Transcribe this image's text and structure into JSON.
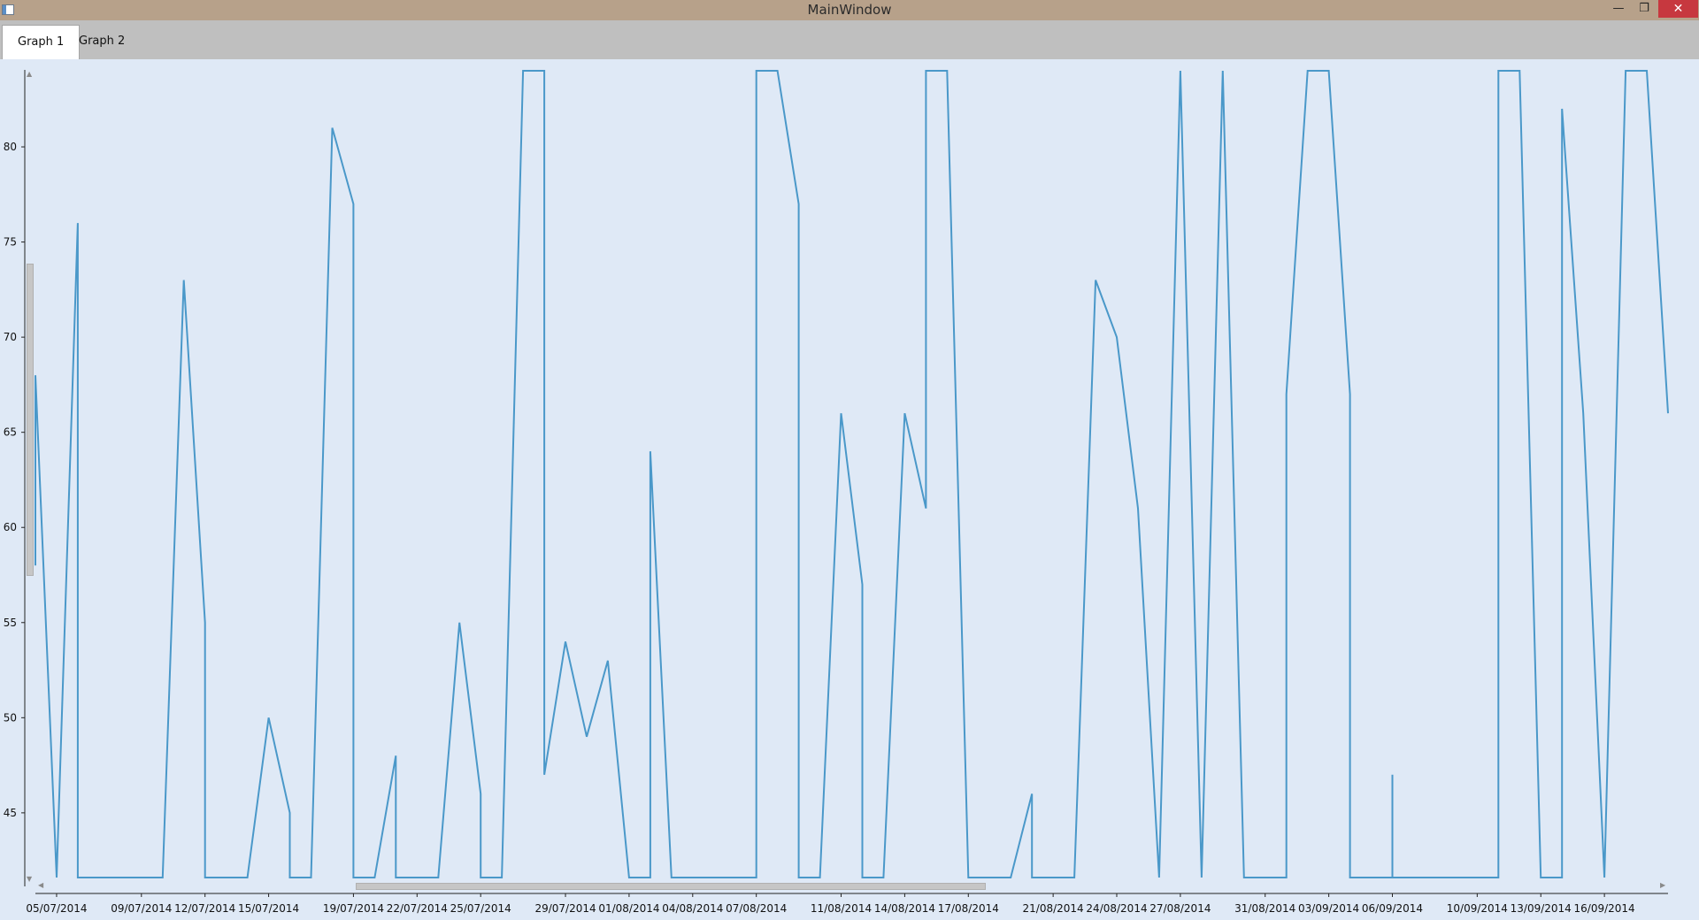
{
  "window": {
    "title": "MainWindow",
    "minimize_glyph": "—",
    "maximize_glyph": "❐",
    "close_glyph": "✕",
    "icons": {
      "app": "app-window-icon",
      "minimize": "minimize-icon",
      "maximize": "restore-icon",
      "close": "close-icon"
    }
  },
  "tabs": [
    {
      "label": "Graph 1",
      "selected": true
    },
    {
      "label": "Graph 2",
      "selected": false
    }
  ],
  "colors": {
    "titlebar": "#b7a18a",
    "close": "#c7383f",
    "tabstrip": "#bfbfbf",
    "plot_background": "#dfe9f6",
    "series_line": "#4a98c9"
  },
  "scrollbars": {
    "vertical": {
      "position": 0.28,
      "visible_fraction": 0.38
    },
    "horizontal": {
      "position": 0.21,
      "visible_fraction": 0.38
    }
  },
  "chart_data": {
    "type": "line",
    "title": "",
    "xlabel": "",
    "ylabel": "",
    "xlim": [
      "2014-07-04",
      "2014-09-19"
    ],
    "ylim": [
      41.6,
      84
    ],
    "grid": false,
    "y_ticks": [
      45,
      50,
      55,
      60,
      65,
      70,
      75,
      80
    ],
    "x_ticks": [
      "05/07/2014",
      "09/07/2014",
      "12/07/2014",
      "15/07/2014",
      "19/07/2014",
      "22/07/2014",
      "25/07/2014",
      "29/07/2014",
      "01/08/2014",
      "04/08/2014",
      "07/08/2014",
      "11/08/2014",
      "14/08/2014",
      "17/08/2014",
      "21/08/2014",
      "24/08/2014",
      "27/08/2014",
      "31/08/2014",
      "03/09/2014",
      "06/09/2014",
      "10/09/2014",
      "13/09/2014",
      "16/09/2014"
    ],
    "series": [
      {
        "color": "#4a98c9",
        "points": [
          {
            "x": "2014-07-04",
            "y": 58
          },
          {
            "x": "2014-07-04",
            "y": 68
          },
          {
            "x": "2014-07-05",
            "y": 41.6
          },
          {
            "x": "2014-07-05",
            "y": 41.6
          },
          {
            "x": "2014-07-06",
            "y": 76
          },
          {
            "x": "2014-07-06",
            "y": 41.6
          },
          {
            "x": "2014-07-10",
            "y": 41.6
          },
          {
            "x": "2014-07-11",
            "y": 73
          },
          {
            "x": "2014-07-12",
            "y": 55
          },
          {
            "x": "2014-07-12",
            "y": 41.6
          },
          {
            "x": "2014-07-14",
            "y": 41.6
          },
          {
            "x": "2014-07-15",
            "y": 50
          },
          {
            "x": "2014-07-16",
            "y": 45
          },
          {
            "x": "2014-07-16",
            "y": 41.6
          },
          {
            "x": "2014-07-17",
            "y": 41.6
          },
          {
            "x": "2014-07-18",
            "y": 81
          },
          {
            "x": "2014-07-19",
            "y": 77
          },
          {
            "x": "2014-07-19",
            "y": 41.6
          },
          {
            "x": "2014-07-20",
            "y": 41.6
          },
          {
            "x": "2014-07-21",
            "y": 48
          },
          {
            "x": "2014-07-21",
            "y": 41.6
          },
          {
            "x": "2014-07-23",
            "y": 41.6
          },
          {
            "x": "2014-07-24",
            "y": 55
          },
          {
            "x": "2014-07-25",
            "y": 46
          },
          {
            "x": "2014-07-25",
            "y": 41.6
          },
          {
            "x": "2014-07-26",
            "y": 41.6
          },
          {
            "x": "2014-07-27",
            "y": 84
          },
          {
            "x": "2014-07-28",
            "y": 84
          },
          {
            "x": "2014-07-28",
            "y": 47
          },
          {
            "x": "2014-07-29",
            "y": 54
          },
          {
            "x": "2014-07-30",
            "y": 49
          },
          {
            "x": "2014-07-31",
            "y": 53
          },
          {
            "x": "2014-08-01",
            "y": 41.6
          },
          {
            "x": "2014-08-02",
            "y": 41.6
          },
          {
            "x": "2014-08-02",
            "y": 64
          },
          {
            "x": "2014-08-03",
            "y": 41.6
          },
          {
            "x": "2014-08-07",
            "y": 41.6
          },
          {
            "x": "2014-08-07",
            "y": 84
          },
          {
            "x": "2014-08-08",
            "y": 84
          },
          {
            "x": "2014-08-09",
            "y": 77
          },
          {
            "x": "2014-08-09",
            "y": 41.6
          },
          {
            "x": "2014-08-10",
            "y": 41.6
          },
          {
            "x": "2014-08-11",
            "y": 66
          },
          {
            "x": "2014-08-12",
            "y": 57
          },
          {
            "x": "2014-08-12",
            "y": 41.6
          },
          {
            "x": "2014-08-13",
            "y": 41.6
          },
          {
            "x": "2014-08-14",
            "y": 66
          },
          {
            "x": "2014-08-15",
            "y": 61
          },
          {
            "x": "2014-08-15",
            "y": 84
          },
          {
            "x": "2014-08-16",
            "y": 84
          },
          {
            "x": "2014-08-17",
            "y": 41.6
          },
          {
            "x": "2014-08-19",
            "y": 41.6
          },
          {
            "x": "2014-08-20",
            "y": 46
          },
          {
            "x": "2014-08-20",
            "y": 41.6
          },
          {
            "x": "2014-08-22",
            "y": 41.6
          },
          {
            "x": "2014-08-23",
            "y": 73
          },
          {
            "x": "2014-08-24",
            "y": 70
          },
          {
            "x": "2014-08-25",
            "y": 61
          },
          {
            "x": "2014-08-26",
            "y": 41.6
          },
          {
            "x": "2014-08-26",
            "y": 41.6
          },
          {
            "x": "2014-08-27",
            "y": 84
          },
          {
            "x": "2014-08-27",
            "y": 84
          },
          {
            "x": "2014-08-28",
            "y": 41.6
          },
          {
            "x": "2014-08-28",
            "y": 41.6
          },
          {
            "x": "2014-08-29",
            "y": 84
          },
          {
            "x": "2014-08-29",
            "y": 84
          },
          {
            "x": "2014-08-30",
            "y": 41.6
          },
          {
            "x": "2014-09-01",
            "y": 41.6
          },
          {
            "x": "2014-09-01",
            "y": 67
          },
          {
            "x": "2014-09-02",
            "y": 84
          },
          {
            "x": "2014-09-03",
            "y": 84
          },
          {
            "x": "2014-09-04",
            "y": 67
          },
          {
            "x": "2014-09-04",
            "y": 41.6
          },
          {
            "x": "2014-09-06",
            "y": 41.6
          },
          {
            "x": "2014-09-06",
            "y": 47
          },
          {
            "x": "2014-09-06",
            "y": 41.6
          },
          {
            "x": "2014-09-11",
            "y": 41.6
          },
          {
            "x": "2014-09-11",
            "y": 84
          },
          {
            "x": "2014-09-12",
            "y": 84
          },
          {
            "x": "2014-09-13",
            "y": 41.6
          },
          {
            "x": "2014-09-14",
            "y": 41.6
          },
          {
            "x": "2014-09-14",
            "y": 82
          },
          {
            "x": "2014-09-15",
            "y": 66
          },
          {
            "x": "2014-09-16",
            "y": 41.6
          },
          {
            "x": "2014-09-16",
            "y": 41.6
          },
          {
            "x": "2014-09-17",
            "y": 84
          },
          {
            "x": "2014-09-18",
            "y": 84
          },
          {
            "x": "2014-09-19",
            "y": 66
          }
        ]
      }
    ]
  }
}
